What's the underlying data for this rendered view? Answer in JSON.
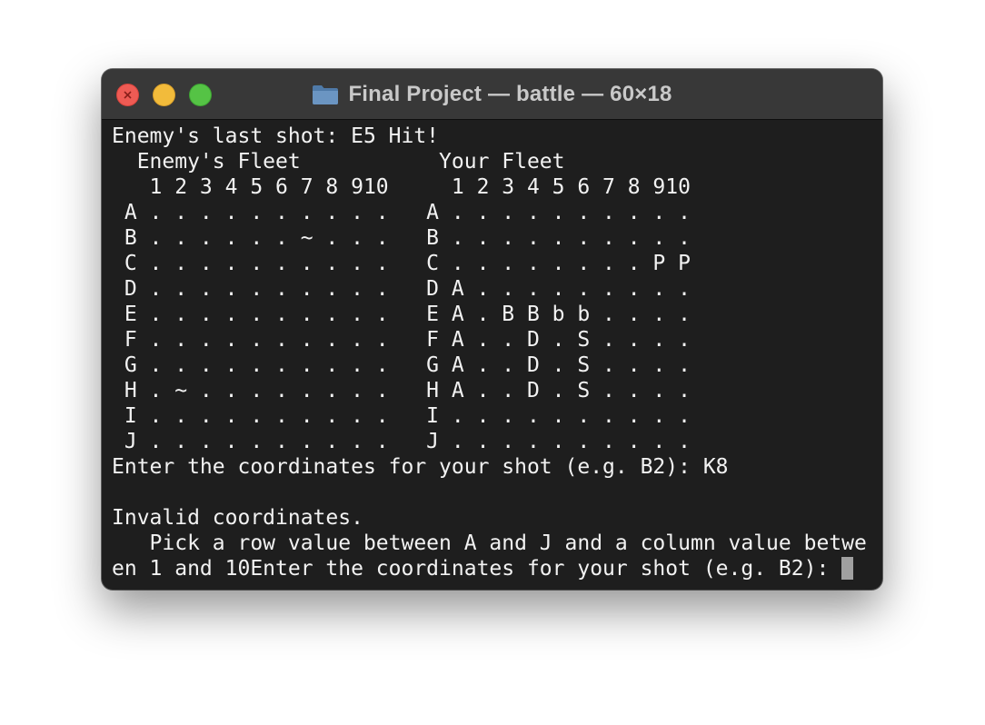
{
  "window": {
    "title": "Final Project — battle — 60×18",
    "icon": "folder-icon",
    "controls": {
      "close": "close-button",
      "minimize": "minimize-button",
      "zoom": "zoom-button"
    }
  },
  "colors": {
    "terminal_background": "#1e1e1e",
    "titlebar_background": "#383838",
    "text": "#f2f2f2",
    "title_text": "#c9c9c9",
    "close": "#ee5b54",
    "minimize": "#f2bb3b",
    "zoom": "#55c345",
    "cursor": "#a0a0a0",
    "folder": "#5d87b4"
  },
  "terminal": {
    "lines": [
      "Enemy's last shot: E5 Hit!",
      "  Enemy's Fleet           Your Fleet",
      "   1 2 3 4 5 6 7 8 910     1 2 3 4 5 6 7 8 910",
      " A . . . . . . . . . .   A . . . . . . . . . .",
      " B . . . . . . ~ . . .   B . . . . . . . . . .",
      " C . . . . . . . . . .   C . . . . . . . . P P",
      " D . . . . . . . . . .   D A . . . . . . . . .",
      " E . . . . . . . . . .   E A . B B b b . . . .",
      " F . . . . . . . . . .   F A . . D . S . . . .",
      " G . . . . . . . . . .   G A . . D . S . . . .",
      " H . ~ . . . . . . . .   H A . . D . S . . . .",
      " I . . . . . . . . . .   I . . . . . . . . . .",
      " J . . . . . . . . . .   J . . . . . . . . . .",
      "Enter the coordinates for your shot (e.g. B2): K8",
      "",
      "Invalid coordinates.",
      "   Pick a row value between A and J and a column value betwe",
      "en 1 and 10Enter the coordinates for your shot (e.g. B2): "
    ]
  }
}
